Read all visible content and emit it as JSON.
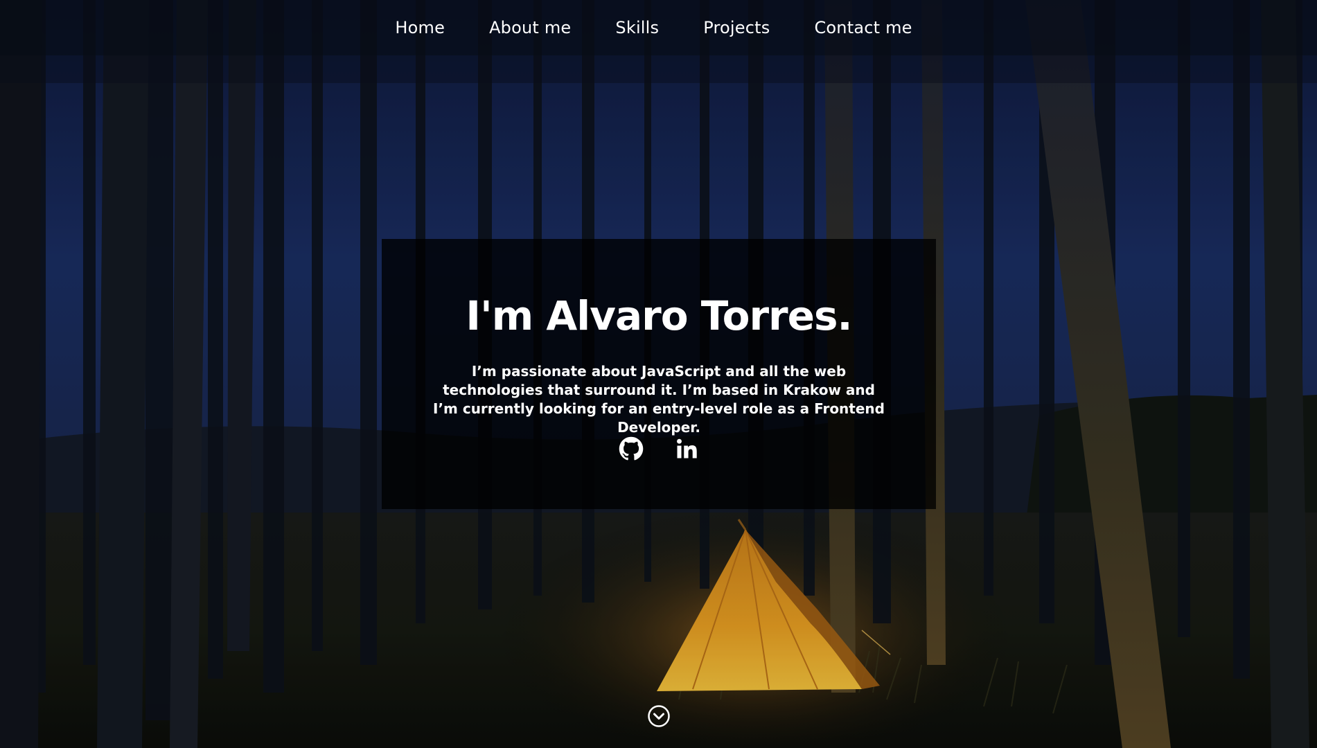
{
  "nav": {
    "items": [
      {
        "label": "Home"
      },
      {
        "label": "About me"
      },
      {
        "label": "Skills"
      },
      {
        "label": "Projects"
      },
      {
        "label": "Contact me"
      }
    ]
  },
  "hero": {
    "title": "I'm Alvaro Torres.",
    "description": "I’m passionate about JavaScript and all the web technologies that surround it. I’m based in Krakow and I’m currently looking for an entry-level role as a Frontend Developer.",
    "social": [
      {
        "icon": "github-icon"
      },
      {
        "icon": "linkedin-icon"
      }
    ]
  },
  "scroll": {
    "icon": "chevron-down-circle-icon"
  },
  "colors": {
    "text": "#ffffff",
    "sky": "#1c2f63",
    "tent": "#f5a020",
    "card": "#000000"
  }
}
